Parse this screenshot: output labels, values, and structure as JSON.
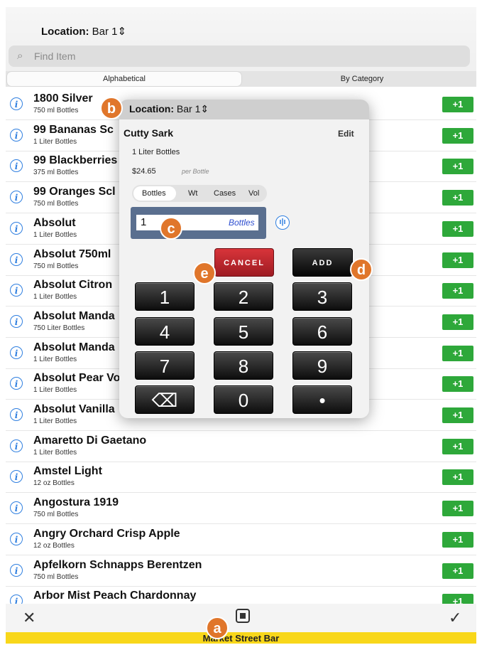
{
  "header": {
    "location_label": "Location:",
    "location_value": "Bar 1",
    "chevron": "⇕",
    "search_placeholder": "Find Item"
  },
  "segments": {
    "a": "Alphabetical",
    "b": "By Category"
  },
  "items": [
    {
      "name": "1800 Silver",
      "size": "750 ml Bottles"
    },
    {
      "name": "99 Bananas Sc",
      "size": "1 Liter Bottles"
    },
    {
      "name": "99 Blackberries",
      "size": "375 ml Bottles"
    },
    {
      "name": "99 Oranges Scl",
      "size": "750 ml Bottles"
    },
    {
      "name": "Absolut",
      "size": "1 Liter Bottles"
    },
    {
      "name": "Absolut 750ml",
      "size": "750 ml Bottles"
    },
    {
      "name": "Absolut Citron",
      "size": "1 Liter Bottles"
    },
    {
      "name": "Absolut Manda",
      "size": "750 Liter Bottles"
    },
    {
      "name": "Absolut Manda",
      "size": "1 Liter Bottles"
    },
    {
      "name": "Absolut Pear Vo",
      "size": "1 Liter Bottles"
    },
    {
      "name": "Absolut Vanilla",
      "size": "1 Liter Bottles"
    },
    {
      "name": "Amaretto Di Gaetano",
      "size": "1 Liter Bottles"
    },
    {
      "name": "Amstel Light",
      "size": "12 oz Bottles"
    },
    {
      "name": "Angostura 1919",
      "size": "750 ml Bottles"
    },
    {
      "name": "Angry Orchard Crisp Apple",
      "size": "12 oz Bottles"
    },
    {
      "name": "Apfelkorn Schnapps Berentzen",
      "size": "750 ml Bottles"
    },
    {
      "name": "Arbor Mist Peach Chardonnay",
      "size": ""
    }
  ],
  "plus_label": "+1",
  "info_glyph": "i",
  "modal": {
    "location_label": "Location:",
    "location_value": "Bar 1",
    "item_name": "Cutty Sark",
    "edit_label": "Edit",
    "size": "1 Liter Bottles",
    "price": "$24.65",
    "per": "per Bottle",
    "units": [
      "Bottles",
      "Wt",
      "Cases",
      "Vol"
    ],
    "qty_value": "1",
    "qty_unit": "Bottles",
    "cancel_label": "CANCEL",
    "add_label": "ADD",
    "keys": [
      "1",
      "2",
      "3",
      "4",
      "5",
      "6",
      "7",
      "8",
      "9",
      "⌫",
      "0",
      "•"
    ]
  },
  "badges": {
    "a": "a",
    "b": "b",
    "c": "c",
    "d": "d",
    "e": "e"
  },
  "bottom": {
    "close": "✕",
    "check": "✓",
    "footer": "Market Street Bar"
  }
}
